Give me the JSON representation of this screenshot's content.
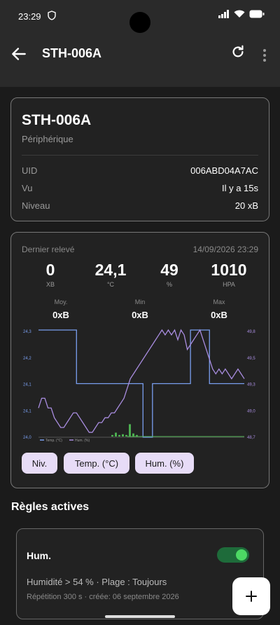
{
  "status": {
    "time": "23:29"
  },
  "appbar": {
    "title": "STH-006A"
  },
  "device": {
    "name": "STH-006A",
    "type": "Périphérique",
    "rows": [
      {
        "key": "UID",
        "value": "006ABD04A7AC"
      },
      {
        "key": "Vu",
        "value": "Il y a 15s"
      },
      {
        "key": "Niveau",
        "value": "20 xB"
      }
    ]
  },
  "reading": {
    "label": "Dernier relevé",
    "timestamp": "14/09/2026 23:29",
    "metrics": [
      {
        "value": "0",
        "unit": "XB"
      },
      {
        "value": "24,1",
        "unit": "°C"
      },
      {
        "value": "49",
        "unit": "%"
      },
      {
        "value": "1010",
        "unit": "HPA"
      }
    ],
    "stats": [
      {
        "label": "Moy.",
        "value": "0xB"
      },
      {
        "label": "Min",
        "value": "0xB"
      },
      {
        "label": "Max",
        "value": "0xB"
      }
    ],
    "chips": [
      "Niv.",
      "Temp. (°C)",
      "Hum. (%)"
    ]
  },
  "chart_data": {
    "type": "line",
    "left_axis_ticks": [
      "24,3",
      "24,2",
      "24,1",
      "24,1",
      "24,0"
    ],
    "right_axis_ticks": [
      "49,8",
      "49,5",
      "49,3",
      "49,0",
      "48,7"
    ],
    "legend": [
      "Temp. (°C)",
      "Hum. (%)"
    ],
    "series": [
      {
        "name": "Temp. (°C)",
        "color": "#7a9ff0",
        "values": [
          24.3,
          24.3,
          24.3,
          24.3,
          24.3,
          24.3,
          24.3,
          24.3,
          24.3,
          24.3,
          24.3,
          24.3,
          24.15,
          24.15,
          24.15,
          24.15,
          24.15,
          24.15,
          24.15,
          24.15,
          24.15,
          24.15,
          24.15,
          24.15,
          24.15,
          24.15,
          24.15,
          24.15,
          24.15,
          24.15,
          24.15,
          24.15,
          24.15,
          24.0,
          24.0,
          24.0,
          24.15,
          24.15,
          24.15,
          24.15,
          24.15,
          24.15,
          24.15,
          24.15,
          24.15,
          24.15,
          24.15,
          24.15,
          24.3,
          24.3,
          24.3,
          24.3,
          24.3,
          24.3,
          24.15,
          24.15,
          24.15,
          24.15,
          24.15,
          24.15,
          24.15,
          24.15,
          24.15,
          24.15,
          24.15,
          24.15
        ]
      },
      {
        "name": "Hum. (%)",
        "color": "#a98de0",
        "values": [
          49.0,
          49.1,
          49.1,
          49.0,
          49.0,
          48.9,
          48.85,
          48.8,
          48.8,
          48.85,
          48.9,
          48.95,
          48.95,
          48.9,
          48.85,
          48.8,
          48.75,
          48.75,
          48.8,
          48.85,
          48.85,
          48.9,
          48.9,
          48.95,
          48.95,
          49.0,
          49.05,
          49.1,
          49.2,
          49.3,
          49.35,
          49.4,
          49.45,
          49.5,
          49.55,
          49.6,
          49.65,
          49.7,
          49.75,
          49.8,
          49.75,
          49.8,
          49.75,
          49.8,
          49.7,
          49.8,
          49.75,
          49.6,
          49.65,
          49.7,
          49.75,
          49.8,
          49.7,
          49.6,
          49.5,
          49.4,
          49.35,
          49.4,
          49.35,
          49.4,
          49.35,
          49.3,
          49.35,
          49.4,
          49.35,
          49.3
        ]
      },
      {
        "name": "Niv.",
        "color": "#4caf50",
        "values": [
          0,
          0,
          0,
          0,
          0,
          0,
          0,
          0,
          0,
          0,
          0,
          0,
          0,
          0,
          0,
          0,
          0,
          0,
          0,
          0,
          0,
          0,
          0,
          0,
          0,
          0,
          0,
          0,
          0,
          0,
          0,
          0,
          0,
          0,
          0,
          0,
          0,
          0,
          0,
          0,
          0,
          0,
          0,
          0,
          0,
          0,
          0,
          0,
          0,
          0,
          0,
          0,
          0,
          0,
          0,
          0,
          0,
          0,
          0,
          0,
          0,
          0,
          0,
          0,
          0,
          0
        ],
        "bars": [
          0.1,
          0.25,
          0.1,
          0.15,
          0.1,
          0.8,
          0.2,
          0.1
        ]
      }
    ]
  },
  "rules": {
    "section_title": "Règles actives",
    "items": [
      {
        "title": "Hum.",
        "enabled": true,
        "description": "Humidité > 54 % · Plage : Toujours",
        "meta": "Répétition 300 s · créée: 06 septembre 2026"
      }
    ]
  },
  "fab": {
    "icon": "plus-icon"
  }
}
